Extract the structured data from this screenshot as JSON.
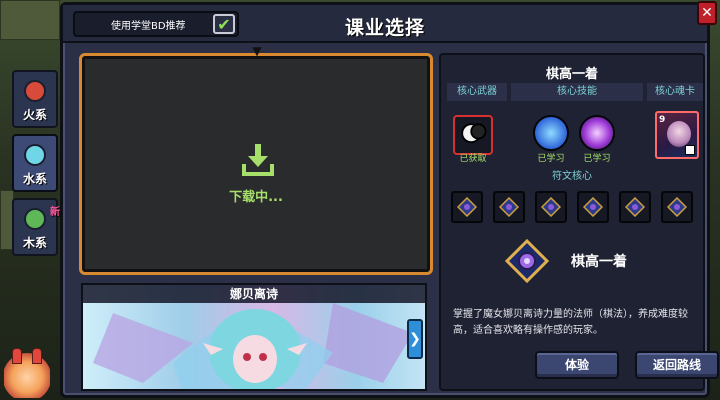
{
  "dialog": {
    "title": "课业选择",
    "recommend_label": "使用学堂BD推荐",
    "recommend_checked": "✔",
    "close_label": "✕"
  },
  "sidebar": {
    "tabs": [
      {
        "label": "火系",
        "gem_color": "#d84a3a"
      },
      {
        "label": "水系",
        "gem_color": "#6fd6e8"
      },
      {
        "label": "木系",
        "gem_color": "#5fb858"
      }
    ],
    "new_badge": "新"
  },
  "preview": {
    "status_text": "下载中...",
    "accent_color": "#d98a30"
  },
  "character": {
    "name": "娜贝离诗",
    "next_arrow": "❯"
  },
  "build": {
    "name": "棋高一着",
    "headers": {
      "weapon": "核心武器",
      "skill": "核心技能",
      "card": "核心魂卡",
      "rune": "符文核心"
    },
    "weapon_status": "已获取",
    "skills": [
      {
        "status": "已学习"
      },
      {
        "status": "已学习"
      }
    ],
    "card_number": "9",
    "rune_core_name": "棋高一着",
    "description": "掌握了魔女娜贝离诗力量的法师（棋法），养成难度较高，适合喜欢略有操作感的玩家。",
    "buttons": {
      "try": "体验",
      "back": "返回路线"
    }
  }
}
